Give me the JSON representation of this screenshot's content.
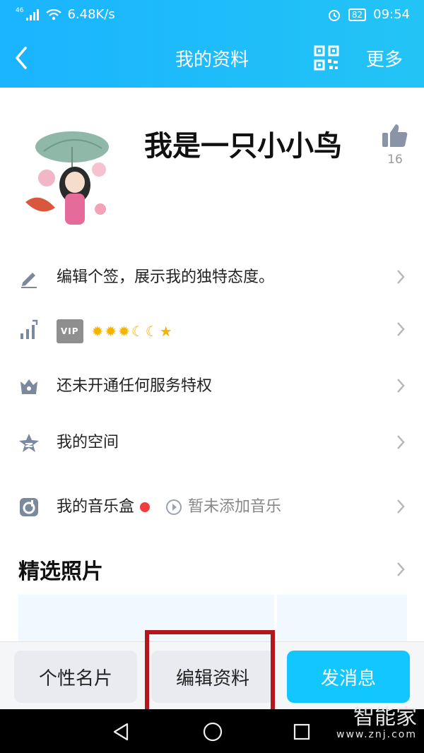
{
  "status_bar": {
    "network": "46",
    "speed": "6.48K/s",
    "battery": "82",
    "time": "09:54"
  },
  "nav": {
    "title": "我的资料",
    "more_label": "更多"
  },
  "profile": {
    "nickname": "我是一只小小鸟",
    "likes": "16"
  },
  "rows": {
    "signature": "编辑个签，展示我的独特态度。",
    "vip_badge": "VIP",
    "service": "还未开通任何服务特权",
    "space": "我的空间",
    "music": "我的音乐盒",
    "music_status": "暂未添加音乐"
  },
  "photos_section": {
    "title": "精选照片"
  },
  "bottom_buttons": {
    "card": "个性名片",
    "edit": "编辑资料",
    "message": "发消息"
  },
  "watermark": {
    "brand": "智能家",
    "url": "www.znj.com"
  },
  "colors": {
    "header": "#1ab4ff",
    "primary_button": "#12c6ff",
    "highlight_box": "#b4161c"
  }
}
